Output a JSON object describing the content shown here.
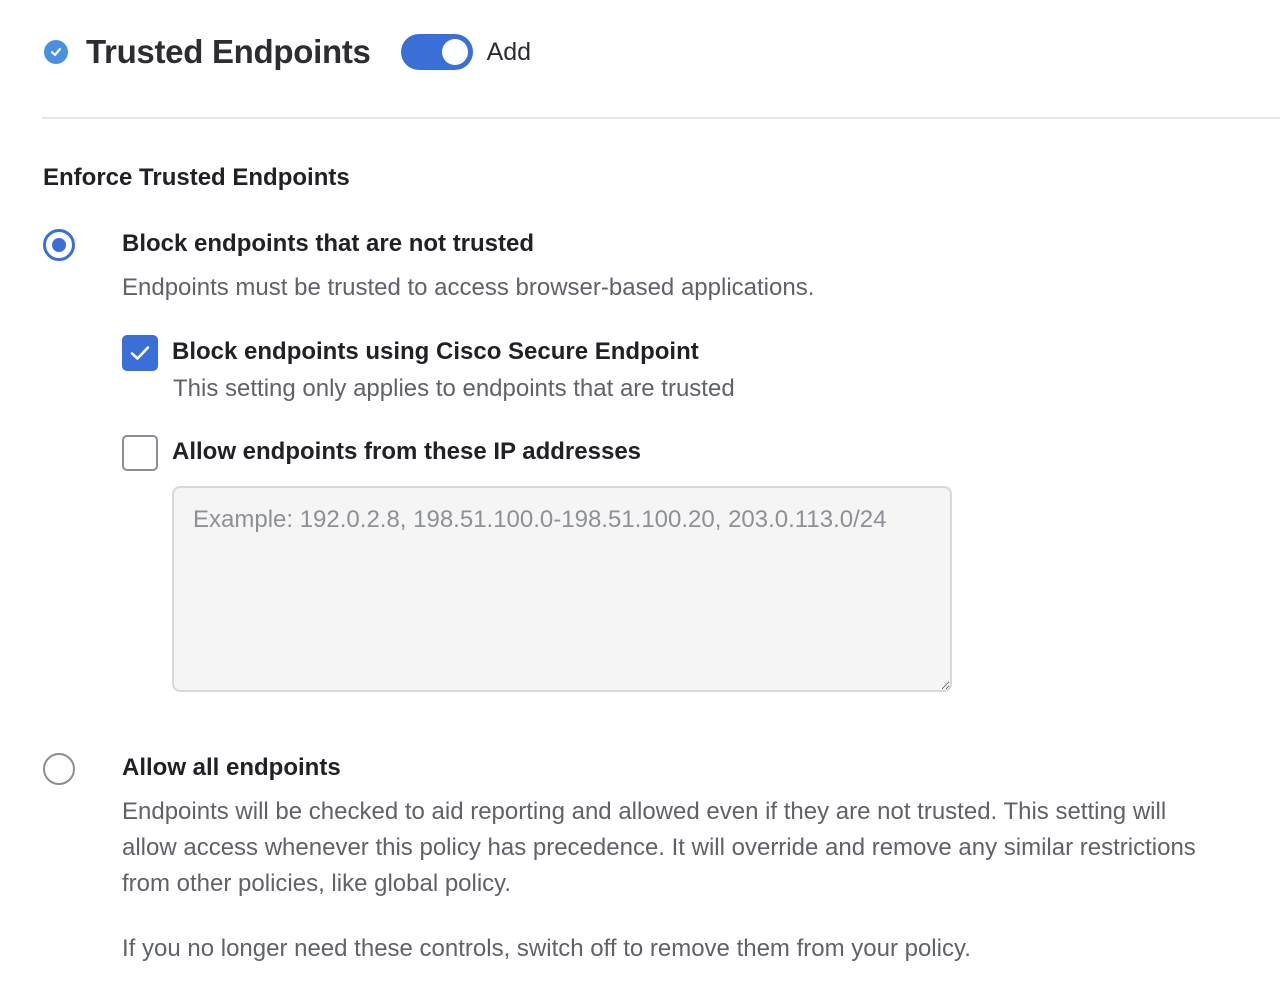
{
  "header": {
    "title": "Trusted Endpoints",
    "toggle_label": "Add",
    "toggle_on": true,
    "status_icon": "check-circle-icon"
  },
  "section": {
    "title": "Enforce Trusted Endpoints"
  },
  "options": [
    {
      "label": "Block endpoints that are not trusted",
      "description": "Endpoints must be trusted to access browser-based applications.",
      "selected": true,
      "sub_options": [
        {
          "label": "Block endpoints using Cisco Secure Endpoint",
          "description": "This setting only applies to endpoints that are trusted",
          "checked": true
        },
        {
          "label": "Allow endpoints from these IP addresses",
          "checked": false,
          "textarea": {
            "value": "",
            "placeholder": "Example: 192.0.2.8, 198.51.100.0-198.51.100.20, 203.0.113.0/24"
          }
        }
      ]
    },
    {
      "label": "Allow all endpoints",
      "description": "Endpoints will be checked to aid reporting and allowed even if they are not trusted. This setting will allow access whenever this policy has precedence. It will override and remove any similar restrictions from other policies, like global policy.",
      "selected": false
    }
  ],
  "footer_note": "If you no longer need these controls, switch off to remove them from your policy.",
  "colors": {
    "accent": "#3a6fd8",
    "status_icon": "#4a90e2",
    "muted_text": "#5f6269",
    "border": "#8a8d93"
  }
}
